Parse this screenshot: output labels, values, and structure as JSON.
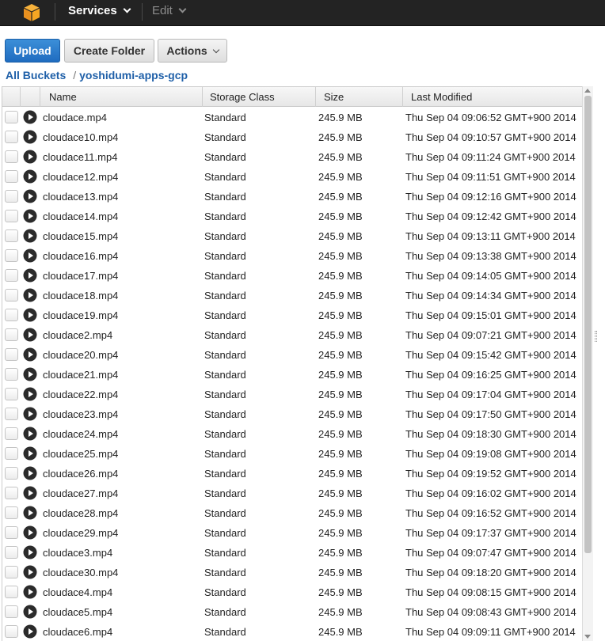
{
  "nav": {
    "services_label": "Services",
    "edit_label": "Edit"
  },
  "toolbar": {
    "upload_label": "Upload",
    "create_folder_label": "Create Folder",
    "actions_label": "Actions"
  },
  "breadcrumb": {
    "root": "All Buckets",
    "separator": "/",
    "bucket": "yoshidumi-apps-gcp"
  },
  "table": {
    "columns": [
      "Name",
      "Storage Class",
      "Size",
      "Last Modified"
    ],
    "rows": [
      {
        "name": "cloudace.mp4",
        "storage_class": "Standard",
        "size": "245.9 MB",
        "last_modified": "Thu Sep 04 09:06:52 GMT+900 2014"
      },
      {
        "name": "cloudace10.mp4",
        "storage_class": "Standard",
        "size": "245.9 MB",
        "last_modified": "Thu Sep 04 09:10:57 GMT+900 2014"
      },
      {
        "name": "cloudace11.mp4",
        "storage_class": "Standard",
        "size": "245.9 MB",
        "last_modified": "Thu Sep 04 09:11:24 GMT+900 2014"
      },
      {
        "name": "cloudace12.mp4",
        "storage_class": "Standard",
        "size": "245.9 MB",
        "last_modified": "Thu Sep 04 09:11:51 GMT+900 2014"
      },
      {
        "name": "cloudace13.mp4",
        "storage_class": "Standard",
        "size": "245.9 MB",
        "last_modified": "Thu Sep 04 09:12:16 GMT+900 2014"
      },
      {
        "name": "cloudace14.mp4",
        "storage_class": "Standard",
        "size": "245.9 MB",
        "last_modified": "Thu Sep 04 09:12:42 GMT+900 2014"
      },
      {
        "name": "cloudace15.mp4",
        "storage_class": "Standard",
        "size": "245.9 MB",
        "last_modified": "Thu Sep 04 09:13:11 GMT+900 2014"
      },
      {
        "name": "cloudace16.mp4",
        "storage_class": "Standard",
        "size": "245.9 MB",
        "last_modified": "Thu Sep 04 09:13:38 GMT+900 2014"
      },
      {
        "name": "cloudace17.mp4",
        "storage_class": "Standard",
        "size": "245.9 MB",
        "last_modified": "Thu Sep 04 09:14:05 GMT+900 2014"
      },
      {
        "name": "cloudace18.mp4",
        "storage_class": "Standard",
        "size": "245.9 MB",
        "last_modified": "Thu Sep 04 09:14:34 GMT+900 2014"
      },
      {
        "name": "cloudace19.mp4",
        "storage_class": "Standard",
        "size": "245.9 MB",
        "last_modified": "Thu Sep 04 09:15:01 GMT+900 2014"
      },
      {
        "name": "cloudace2.mp4",
        "storage_class": "Standard",
        "size": "245.9 MB",
        "last_modified": "Thu Sep 04 09:07:21 GMT+900 2014"
      },
      {
        "name": "cloudace20.mp4",
        "storage_class": "Standard",
        "size": "245.9 MB",
        "last_modified": "Thu Sep 04 09:15:42 GMT+900 2014"
      },
      {
        "name": "cloudace21.mp4",
        "storage_class": "Standard",
        "size": "245.9 MB",
        "last_modified": "Thu Sep 04 09:16:25 GMT+900 2014"
      },
      {
        "name": "cloudace22.mp4",
        "storage_class": "Standard",
        "size": "245.9 MB",
        "last_modified": "Thu Sep 04 09:17:04 GMT+900 2014"
      },
      {
        "name": "cloudace23.mp4",
        "storage_class": "Standard",
        "size": "245.9 MB",
        "last_modified": "Thu Sep 04 09:17:50 GMT+900 2014"
      },
      {
        "name": "cloudace24.mp4",
        "storage_class": "Standard",
        "size": "245.9 MB",
        "last_modified": "Thu Sep 04 09:18:30 GMT+900 2014"
      },
      {
        "name": "cloudace25.mp4",
        "storage_class": "Standard",
        "size": "245.9 MB",
        "last_modified": "Thu Sep 04 09:19:08 GMT+900 2014"
      },
      {
        "name": "cloudace26.mp4",
        "storage_class": "Standard",
        "size": "245.9 MB",
        "last_modified": "Thu Sep 04 09:19:52 GMT+900 2014"
      },
      {
        "name": "cloudace27.mp4",
        "storage_class": "Standard",
        "size": "245.9 MB",
        "last_modified": "Thu Sep 04 09:16:02 GMT+900 2014"
      },
      {
        "name": "cloudace28.mp4",
        "storage_class": "Standard",
        "size": "245.9 MB",
        "last_modified": "Thu Sep 04 09:16:52 GMT+900 2014"
      },
      {
        "name": "cloudace29.mp4",
        "storage_class": "Standard",
        "size": "245.9 MB",
        "last_modified": "Thu Sep 04 09:17:37 GMT+900 2014"
      },
      {
        "name": "cloudace3.mp4",
        "storage_class": "Standard",
        "size": "245.9 MB",
        "last_modified": "Thu Sep 04 09:07:47 GMT+900 2014"
      },
      {
        "name": "cloudace30.mp4",
        "storage_class": "Standard",
        "size": "245.9 MB",
        "last_modified": "Thu Sep 04 09:18:20 GMT+900 2014"
      },
      {
        "name": "cloudace4.mp4",
        "storage_class": "Standard",
        "size": "245.9 MB",
        "last_modified": "Thu Sep 04 09:08:15 GMT+900 2014"
      },
      {
        "name": "cloudace5.mp4",
        "storage_class": "Standard",
        "size": "245.9 MB",
        "last_modified": "Thu Sep 04 09:08:43 GMT+900 2014"
      },
      {
        "name": "cloudace6.mp4",
        "storage_class": "Standard",
        "size": "245.9 MB",
        "last_modified": "Thu Sep 04 09:09:11 GMT+900 2014"
      }
    ]
  },
  "icons": {
    "logo": "aws-cube-icon",
    "row_action": "play-icon",
    "dropdown": "chevron-down-icon"
  },
  "colors": {
    "nav_bg": "#232323",
    "logo_orange": "#f5a623",
    "primary_button": "#1f6cc0",
    "link_blue": "#1e5fa8"
  }
}
